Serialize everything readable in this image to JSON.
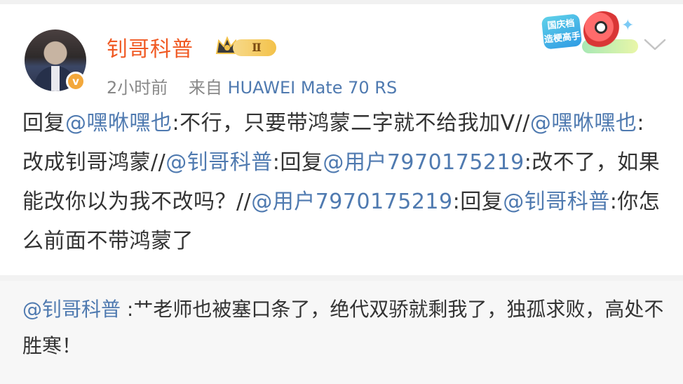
{
  "post": {
    "author": "钊哥科普",
    "rank_badge": "Ⅱ",
    "verify_mark": "v",
    "time": "2小时前",
    "source_prefix": "来自",
    "device": "HUAWEI Mate 70 RS",
    "campaign_badge": "国庆档 造梗高手",
    "body": [
      {
        "type": "text",
        "text": "回复"
      },
      {
        "type": "mention",
        "text": "@嘿咻嘿也"
      },
      {
        "type": "text",
        "text": ":不行，只要带鸿蒙二字就不给我加V//"
      },
      {
        "type": "mention",
        "text": "@嘿咻嘿也"
      },
      {
        "type": "text",
        "text": ":改成钊哥鸿蒙//"
      },
      {
        "type": "mention",
        "text": "@钊哥科普"
      },
      {
        "type": "text",
        "text": ":回复"
      },
      {
        "type": "mention",
        "text": "@用户7970175219"
      },
      {
        "type": "text",
        "text": ":改不了，如果能改你以为我不改吗？//"
      },
      {
        "type": "mention",
        "text": "@用户7970175219"
      },
      {
        "type": "text",
        "text": ":回复"
      },
      {
        "type": "mention",
        "text": "@钊哥科普"
      },
      {
        "type": "text",
        "text": ":你怎么前面不带鸿蒙了"
      }
    ]
  },
  "repost": {
    "author": "@钊哥科普",
    "text": ":艹老师也被塞口条了，绝代双骄就剩我了，独孤求败，高处不胜寒！"
  },
  "colors": {
    "author_name": "#f05a24",
    "mention_link": "#4f7ab0",
    "meta_text": "#888888",
    "body_text": "#333333",
    "repost_background": "#f7f7f7"
  },
  "icons": {
    "crown": "crown-icon",
    "verified": "verified-v-icon",
    "chevron": "chevron-down-icon"
  }
}
